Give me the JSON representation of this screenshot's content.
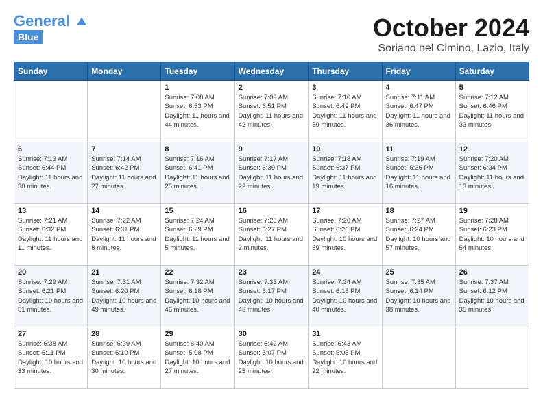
{
  "header": {
    "logo_general": "General",
    "logo_blue": "Blue",
    "month_title": "October 2024",
    "location": "Soriano nel Cimino, Lazio, Italy"
  },
  "calendar": {
    "days_of_week": [
      "Sunday",
      "Monday",
      "Tuesday",
      "Wednesday",
      "Thursday",
      "Friday",
      "Saturday"
    ],
    "weeks": [
      [
        {
          "day": "",
          "sunrise": "",
          "sunset": "",
          "daylight": ""
        },
        {
          "day": "",
          "sunrise": "",
          "sunset": "",
          "daylight": ""
        },
        {
          "day": "1",
          "sunrise": "Sunrise: 7:08 AM",
          "sunset": "Sunset: 6:53 PM",
          "daylight": "Daylight: 11 hours and 44 minutes."
        },
        {
          "day": "2",
          "sunrise": "Sunrise: 7:09 AM",
          "sunset": "Sunset: 6:51 PM",
          "daylight": "Daylight: 11 hours and 42 minutes."
        },
        {
          "day": "3",
          "sunrise": "Sunrise: 7:10 AM",
          "sunset": "Sunset: 6:49 PM",
          "daylight": "Daylight: 11 hours and 39 minutes."
        },
        {
          "day": "4",
          "sunrise": "Sunrise: 7:11 AM",
          "sunset": "Sunset: 6:47 PM",
          "daylight": "Daylight: 11 hours and 36 minutes."
        },
        {
          "day": "5",
          "sunrise": "Sunrise: 7:12 AM",
          "sunset": "Sunset: 6:46 PM",
          "daylight": "Daylight: 11 hours and 33 minutes."
        }
      ],
      [
        {
          "day": "6",
          "sunrise": "Sunrise: 7:13 AM",
          "sunset": "Sunset: 6:44 PM",
          "daylight": "Daylight: 11 hours and 30 minutes."
        },
        {
          "day": "7",
          "sunrise": "Sunrise: 7:14 AM",
          "sunset": "Sunset: 6:42 PM",
          "daylight": "Daylight: 11 hours and 27 minutes."
        },
        {
          "day": "8",
          "sunrise": "Sunrise: 7:16 AM",
          "sunset": "Sunset: 6:41 PM",
          "daylight": "Daylight: 11 hours and 25 minutes."
        },
        {
          "day": "9",
          "sunrise": "Sunrise: 7:17 AM",
          "sunset": "Sunset: 6:39 PM",
          "daylight": "Daylight: 11 hours and 22 minutes."
        },
        {
          "day": "10",
          "sunrise": "Sunrise: 7:18 AM",
          "sunset": "Sunset: 6:37 PM",
          "daylight": "Daylight: 11 hours and 19 minutes."
        },
        {
          "day": "11",
          "sunrise": "Sunrise: 7:19 AM",
          "sunset": "Sunset: 6:36 PM",
          "daylight": "Daylight: 11 hours and 16 minutes."
        },
        {
          "day": "12",
          "sunrise": "Sunrise: 7:20 AM",
          "sunset": "Sunset: 6:34 PM",
          "daylight": "Daylight: 11 hours and 13 minutes."
        }
      ],
      [
        {
          "day": "13",
          "sunrise": "Sunrise: 7:21 AM",
          "sunset": "Sunset: 6:32 PM",
          "daylight": "Daylight: 11 hours and 11 minutes."
        },
        {
          "day": "14",
          "sunrise": "Sunrise: 7:22 AM",
          "sunset": "Sunset: 6:31 PM",
          "daylight": "Daylight: 11 hours and 8 minutes."
        },
        {
          "day": "15",
          "sunrise": "Sunrise: 7:24 AM",
          "sunset": "Sunset: 6:29 PM",
          "daylight": "Daylight: 11 hours and 5 minutes."
        },
        {
          "day": "16",
          "sunrise": "Sunrise: 7:25 AM",
          "sunset": "Sunset: 6:27 PM",
          "daylight": "Daylight: 11 hours and 2 minutes."
        },
        {
          "day": "17",
          "sunrise": "Sunrise: 7:26 AM",
          "sunset": "Sunset: 6:26 PM",
          "daylight": "Daylight: 10 hours and 59 minutes."
        },
        {
          "day": "18",
          "sunrise": "Sunrise: 7:27 AM",
          "sunset": "Sunset: 6:24 PM",
          "daylight": "Daylight: 10 hours and 57 minutes."
        },
        {
          "day": "19",
          "sunrise": "Sunrise: 7:28 AM",
          "sunset": "Sunset: 6:23 PM",
          "daylight": "Daylight: 10 hours and 54 minutes."
        }
      ],
      [
        {
          "day": "20",
          "sunrise": "Sunrise: 7:29 AM",
          "sunset": "Sunset: 6:21 PM",
          "daylight": "Daylight: 10 hours and 51 minutes."
        },
        {
          "day": "21",
          "sunrise": "Sunrise: 7:31 AM",
          "sunset": "Sunset: 6:20 PM",
          "daylight": "Daylight: 10 hours and 49 minutes."
        },
        {
          "day": "22",
          "sunrise": "Sunrise: 7:32 AM",
          "sunset": "Sunset: 6:18 PM",
          "daylight": "Daylight: 10 hours and 46 minutes."
        },
        {
          "day": "23",
          "sunrise": "Sunrise: 7:33 AM",
          "sunset": "Sunset: 6:17 PM",
          "daylight": "Daylight: 10 hours and 43 minutes."
        },
        {
          "day": "24",
          "sunrise": "Sunrise: 7:34 AM",
          "sunset": "Sunset: 6:15 PM",
          "daylight": "Daylight: 10 hours and 40 minutes."
        },
        {
          "day": "25",
          "sunrise": "Sunrise: 7:35 AM",
          "sunset": "Sunset: 6:14 PM",
          "daylight": "Daylight: 10 hours and 38 minutes."
        },
        {
          "day": "26",
          "sunrise": "Sunrise: 7:37 AM",
          "sunset": "Sunset: 6:12 PM",
          "daylight": "Daylight: 10 hours and 35 minutes."
        }
      ],
      [
        {
          "day": "27",
          "sunrise": "Sunrise: 6:38 AM",
          "sunset": "Sunset: 5:11 PM",
          "daylight": "Daylight: 10 hours and 33 minutes."
        },
        {
          "day": "28",
          "sunrise": "Sunrise: 6:39 AM",
          "sunset": "Sunset: 5:10 PM",
          "daylight": "Daylight: 10 hours and 30 minutes."
        },
        {
          "day": "29",
          "sunrise": "Sunrise: 6:40 AM",
          "sunset": "Sunset: 5:08 PM",
          "daylight": "Daylight: 10 hours and 27 minutes."
        },
        {
          "day": "30",
          "sunrise": "Sunrise: 6:42 AM",
          "sunset": "Sunset: 5:07 PM",
          "daylight": "Daylight: 10 hours and 25 minutes."
        },
        {
          "day": "31",
          "sunrise": "Sunrise: 6:43 AM",
          "sunset": "Sunset: 5:05 PM",
          "daylight": "Daylight: 10 hours and 22 minutes."
        },
        {
          "day": "",
          "sunrise": "",
          "sunset": "",
          "daylight": ""
        },
        {
          "day": "",
          "sunrise": "",
          "sunset": "",
          "daylight": ""
        }
      ]
    ]
  }
}
